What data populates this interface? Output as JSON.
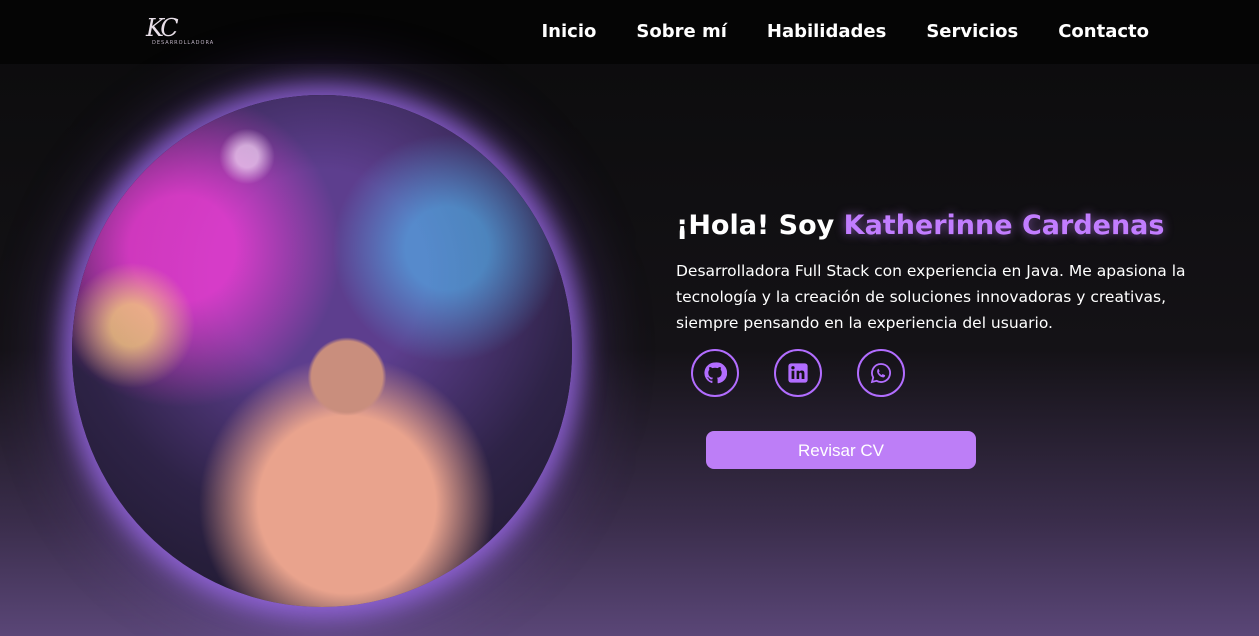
{
  "logo": {
    "mark": "KC",
    "sub": "DESARROLLADORA"
  },
  "nav": [
    {
      "label": "Inicio"
    },
    {
      "label": "Sobre mí"
    },
    {
      "label": "Habilidades"
    },
    {
      "label": "Servicios"
    },
    {
      "label": "Contacto"
    }
  ],
  "hero": {
    "greeting_prefix": "¡Hola! Soy ",
    "name": "Katherinne Cardenas",
    "description": "Desarrolladora Full Stack con experiencia en Java. Me apasiona la tecnología y la creación de soluciones innovadoras y creativas, siempre pensando en la experiencia del usuario.",
    "button": "Revisar CV",
    "accent": "#c27dff"
  },
  "socials": [
    {
      "icon": "github-icon"
    },
    {
      "icon": "linkedin-icon"
    },
    {
      "icon": "whatsapp-icon"
    }
  ]
}
